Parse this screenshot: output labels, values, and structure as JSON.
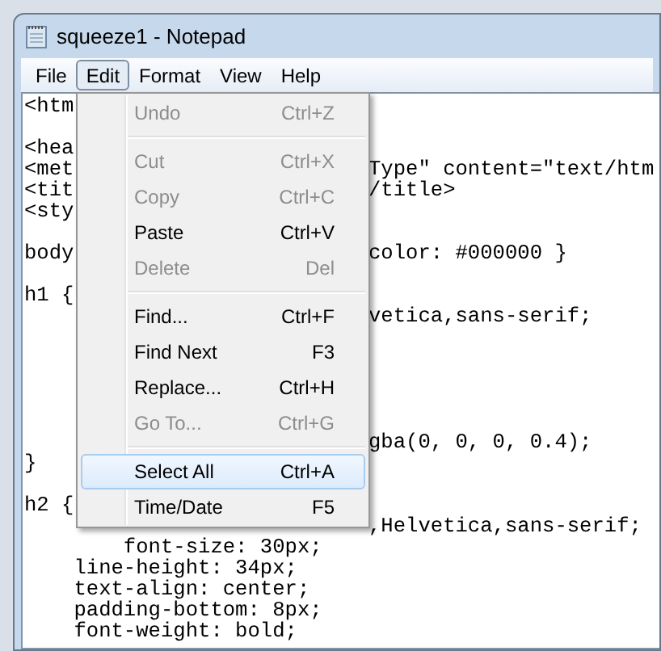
{
  "window": {
    "title": "squeeze1 - Notepad"
  },
  "menu_bar": [
    {
      "label": "File",
      "selected": false
    },
    {
      "label": "Edit",
      "selected": true
    },
    {
      "label": "Format",
      "selected": false
    },
    {
      "label": "View",
      "selected": false
    },
    {
      "label": "Help",
      "selected": false
    }
  ],
  "edit_menu": [
    {
      "kind": "item",
      "label": "Undo",
      "shortcut": "Ctrl+Z",
      "disabled": true,
      "selected": false
    },
    {
      "kind": "separator"
    },
    {
      "kind": "item",
      "label": "Cut",
      "shortcut": "Ctrl+X",
      "disabled": true,
      "selected": false
    },
    {
      "kind": "item",
      "label": "Copy",
      "shortcut": "Ctrl+C",
      "disabled": true,
      "selected": false
    },
    {
      "kind": "item",
      "label": "Paste",
      "shortcut": "Ctrl+V",
      "disabled": false,
      "selected": false
    },
    {
      "kind": "item",
      "label": "Delete",
      "shortcut": "Del",
      "disabled": true,
      "selected": false
    },
    {
      "kind": "separator"
    },
    {
      "kind": "item",
      "label": "Find...",
      "shortcut": "Ctrl+F",
      "disabled": false,
      "selected": false
    },
    {
      "kind": "item",
      "label": "Find Next",
      "shortcut": "F3",
      "disabled": false,
      "selected": false
    },
    {
      "kind": "item",
      "label": "Replace...",
      "shortcut": "Ctrl+H",
      "disabled": false,
      "selected": false
    },
    {
      "kind": "item",
      "label": "Go To...",
      "shortcut": "Ctrl+G",
      "disabled": true,
      "selected": false
    },
    {
      "kind": "separator"
    },
    {
      "kind": "item",
      "label": "Select All",
      "shortcut": "Ctrl+A",
      "disabled": false,
      "selected": true
    },
    {
      "kind": "item",
      "label": "Time/Date",
      "shortcut": "F5",
      "disabled": false,
      "selected": false
    }
  ],
  "editor_lines": [
    {
      "kind": "code",
      "text": "<htm"
    },
    {
      "kind": "blank"
    },
    {
      "kind": "code",
      "text": "<hea"
    },
    {
      "kind": "code",
      "text": "<met",
      "right": "Type\" content=\"text/htm"
    },
    {
      "kind": "code",
      "text": "<tit",
      "right": "/title>"
    },
    {
      "kind": "code",
      "text": "<sty"
    },
    {
      "kind": "blank"
    },
    {
      "kind": "code",
      "text": "body",
      "right": "color: #000000 }"
    },
    {
      "kind": "blank"
    },
    {
      "kind": "code",
      "text": "h1 {"
    },
    {
      "kind": "code",
      "right": "vetica,sans-serif;"
    },
    {
      "kind": "blank"
    },
    {
      "kind": "blank"
    },
    {
      "kind": "blank"
    },
    {
      "kind": "blank"
    },
    {
      "kind": "blank"
    },
    {
      "kind": "code",
      "right": "gba(0, 0, 0, 0.4);"
    },
    {
      "kind": "code",
      "text": "}"
    },
    {
      "kind": "blank"
    },
    {
      "kind": "code",
      "text": "h2 {"
    },
    {
      "kind": "code",
      "right": ",Helvetica,sans-serif;"
    },
    {
      "kind": "code",
      "text": "        font-size: 30px;"
    },
    {
      "kind": "code",
      "text": "    line-height: 34px;"
    },
    {
      "kind": "code",
      "text": "    text-align: center;"
    },
    {
      "kind": "code",
      "text": "    padding-bottom: 8px;"
    },
    {
      "kind": "code",
      "text": "    font-weight: bold;"
    }
  ]
}
